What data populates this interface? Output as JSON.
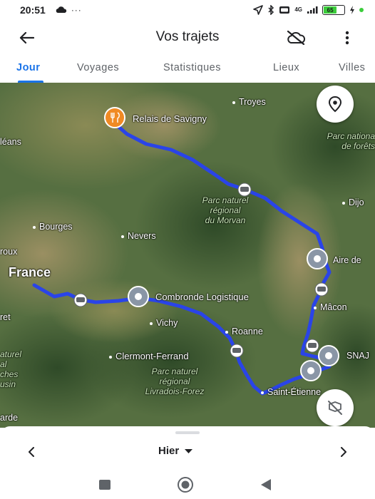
{
  "status_bar": {
    "time": "20:51",
    "extra": "···",
    "network_badge": "4G",
    "battery_level": "65"
  },
  "app_bar": {
    "title": "Vos trajets"
  },
  "tabs": [
    {
      "label": "Jour"
    },
    {
      "label": "Voyages"
    },
    {
      "label": "Statistiques"
    },
    {
      "label": "Lieux"
    },
    {
      "label": "Villes"
    }
  ],
  "map": {
    "places": {
      "troyes": "Troyes",
      "relais": "Relais de Savigny",
      "leans": "léans",
      "parc_forets_1": "Parc nationa",
      "parc_forets_2": "de forêts",
      "dijon": "Dijo",
      "morvan_1": "Parc naturel",
      "morvan_2": "régional",
      "morvan_3": "du Morvan",
      "bourges": "Bourges",
      "nevers": "Nevers",
      "roux": "roux",
      "aire": "Aire de",
      "france": "France",
      "cambronde": "Combronde Logistique",
      "macon": "Mâcon",
      "ret": "ret",
      "vichy": "Vichy",
      "roanne": "Roanne",
      "snaj": "SNAJ",
      "clermont": "Clermont-Ferrand",
      "livradois_1": "Parc naturel",
      "livradois_2": "régional",
      "livradois_3": "Livradois-Forez",
      "saint_etienne": "Saint-Étienne",
      "left_1": "aturel",
      "left_2": "al",
      "left_3": "ches",
      "left_4": "usin",
      "garde": "arde"
    },
    "colors": {
      "route": "#2a44e8",
      "pin_orange": "#f08a24",
      "pin_gray": "#8a96a6"
    }
  },
  "bottom_sheet": {
    "date_label": "Hier"
  }
}
